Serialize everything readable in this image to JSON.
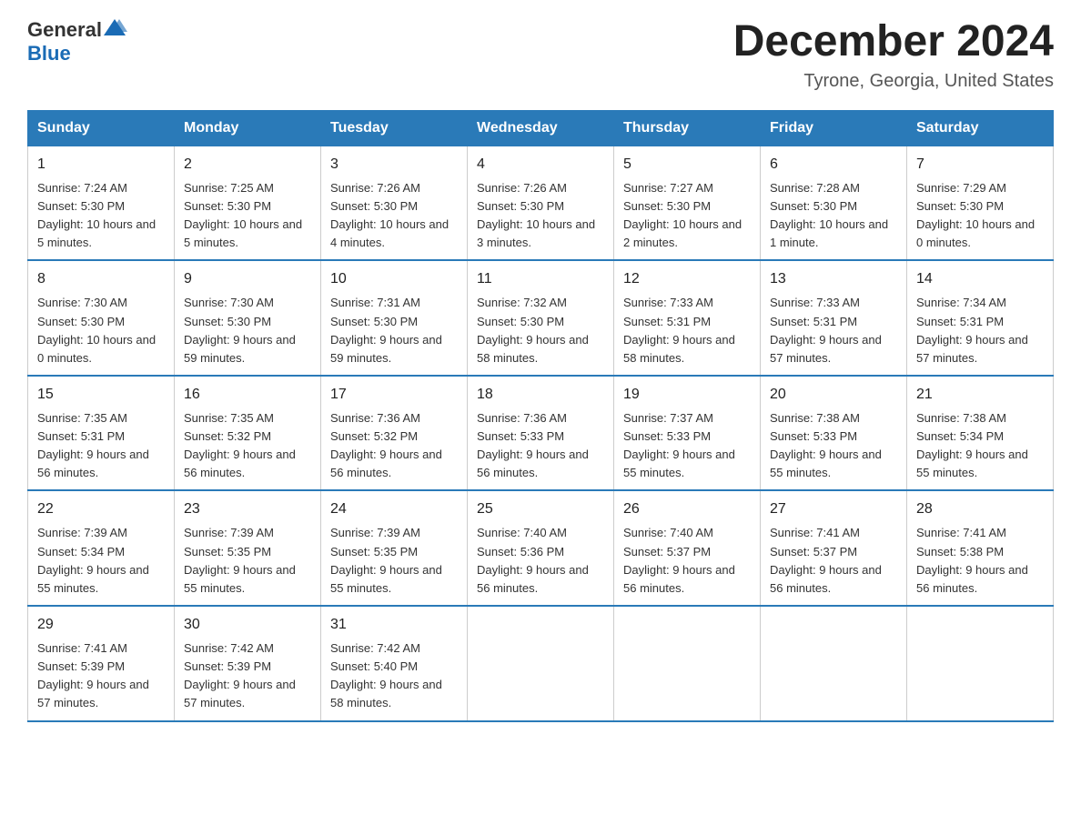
{
  "header": {
    "month_year": "December 2024",
    "location": "Tyrone, Georgia, United States"
  },
  "logo": {
    "general": "General",
    "blue": "Blue"
  },
  "days_of_week": [
    "Sunday",
    "Monday",
    "Tuesday",
    "Wednesday",
    "Thursday",
    "Friday",
    "Saturday"
  ],
  "weeks": [
    [
      {
        "day": "1",
        "sunrise": "7:24 AM",
        "sunset": "5:30 PM",
        "daylight": "10 hours and 5 minutes."
      },
      {
        "day": "2",
        "sunrise": "7:25 AM",
        "sunset": "5:30 PM",
        "daylight": "10 hours and 5 minutes."
      },
      {
        "day": "3",
        "sunrise": "7:26 AM",
        "sunset": "5:30 PM",
        "daylight": "10 hours and 4 minutes."
      },
      {
        "day": "4",
        "sunrise": "7:26 AM",
        "sunset": "5:30 PM",
        "daylight": "10 hours and 3 minutes."
      },
      {
        "day": "5",
        "sunrise": "7:27 AM",
        "sunset": "5:30 PM",
        "daylight": "10 hours and 2 minutes."
      },
      {
        "day": "6",
        "sunrise": "7:28 AM",
        "sunset": "5:30 PM",
        "daylight": "10 hours and 1 minute."
      },
      {
        "day": "7",
        "sunrise": "7:29 AM",
        "sunset": "5:30 PM",
        "daylight": "10 hours and 0 minutes."
      }
    ],
    [
      {
        "day": "8",
        "sunrise": "7:30 AM",
        "sunset": "5:30 PM",
        "daylight": "10 hours and 0 minutes."
      },
      {
        "day": "9",
        "sunrise": "7:30 AM",
        "sunset": "5:30 PM",
        "daylight": "9 hours and 59 minutes."
      },
      {
        "day": "10",
        "sunrise": "7:31 AM",
        "sunset": "5:30 PM",
        "daylight": "9 hours and 59 minutes."
      },
      {
        "day": "11",
        "sunrise": "7:32 AM",
        "sunset": "5:30 PM",
        "daylight": "9 hours and 58 minutes."
      },
      {
        "day": "12",
        "sunrise": "7:33 AM",
        "sunset": "5:31 PM",
        "daylight": "9 hours and 58 minutes."
      },
      {
        "day": "13",
        "sunrise": "7:33 AM",
        "sunset": "5:31 PM",
        "daylight": "9 hours and 57 minutes."
      },
      {
        "day": "14",
        "sunrise": "7:34 AM",
        "sunset": "5:31 PM",
        "daylight": "9 hours and 57 minutes."
      }
    ],
    [
      {
        "day": "15",
        "sunrise": "7:35 AM",
        "sunset": "5:31 PM",
        "daylight": "9 hours and 56 minutes."
      },
      {
        "day": "16",
        "sunrise": "7:35 AM",
        "sunset": "5:32 PM",
        "daylight": "9 hours and 56 minutes."
      },
      {
        "day": "17",
        "sunrise": "7:36 AM",
        "sunset": "5:32 PM",
        "daylight": "9 hours and 56 minutes."
      },
      {
        "day": "18",
        "sunrise": "7:36 AM",
        "sunset": "5:33 PM",
        "daylight": "9 hours and 56 minutes."
      },
      {
        "day": "19",
        "sunrise": "7:37 AM",
        "sunset": "5:33 PM",
        "daylight": "9 hours and 55 minutes."
      },
      {
        "day": "20",
        "sunrise": "7:38 AM",
        "sunset": "5:33 PM",
        "daylight": "9 hours and 55 minutes."
      },
      {
        "day": "21",
        "sunrise": "7:38 AM",
        "sunset": "5:34 PM",
        "daylight": "9 hours and 55 minutes."
      }
    ],
    [
      {
        "day": "22",
        "sunrise": "7:39 AM",
        "sunset": "5:34 PM",
        "daylight": "9 hours and 55 minutes."
      },
      {
        "day": "23",
        "sunrise": "7:39 AM",
        "sunset": "5:35 PM",
        "daylight": "9 hours and 55 minutes."
      },
      {
        "day": "24",
        "sunrise": "7:39 AM",
        "sunset": "5:35 PM",
        "daylight": "9 hours and 55 minutes."
      },
      {
        "day": "25",
        "sunrise": "7:40 AM",
        "sunset": "5:36 PM",
        "daylight": "9 hours and 56 minutes."
      },
      {
        "day": "26",
        "sunrise": "7:40 AM",
        "sunset": "5:37 PM",
        "daylight": "9 hours and 56 minutes."
      },
      {
        "day": "27",
        "sunrise": "7:41 AM",
        "sunset": "5:37 PM",
        "daylight": "9 hours and 56 minutes."
      },
      {
        "day": "28",
        "sunrise": "7:41 AM",
        "sunset": "5:38 PM",
        "daylight": "9 hours and 56 minutes."
      }
    ],
    [
      {
        "day": "29",
        "sunrise": "7:41 AM",
        "sunset": "5:39 PM",
        "daylight": "9 hours and 57 minutes."
      },
      {
        "day": "30",
        "sunrise": "7:42 AM",
        "sunset": "5:39 PM",
        "daylight": "9 hours and 57 minutes."
      },
      {
        "day": "31",
        "sunrise": "7:42 AM",
        "sunset": "5:40 PM",
        "daylight": "9 hours and 58 minutes."
      },
      {
        "day": "",
        "sunrise": "",
        "sunset": "",
        "daylight": ""
      },
      {
        "day": "",
        "sunrise": "",
        "sunset": "",
        "daylight": ""
      },
      {
        "day": "",
        "sunrise": "",
        "sunset": "",
        "daylight": ""
      },
      {
        "day": "",
        "sunrise": "",
        "sunset": "",
        "daylight": ""
      }
    ]
  ]
}
